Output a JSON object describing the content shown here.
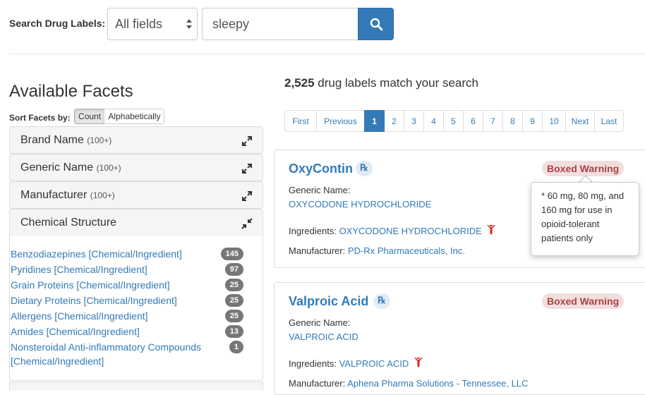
{
  "search": {
    "label": "Search Drug Labels:",
    "field_selected": "All fields",
    "query": "sleepy"
  },
  "facets": {
    "title": "Available Facets",
    "sort_label": "Sort Facets by:",
    "sort_options": [
      "Count",
      "Alphabetically"
    ],
    "panels": [
      {
        "name": "Brand Name",
        "count": "(100+)"
      },
      {
        "name": "Generic Name",
        "count": "(100+)"
      },
      {
        "name": "Manufacturer",
        "count": "(100+)"
      },
      {
        "name": "Chemical Structure",
        "count": ""
      }
    ],
    "chemical_items": [
      {
        "label": "Benzodiazepines [Chemical/Ingredient]",
        "count": "145"
      },
      {
        "label": "Pyridines [Chemical/Ingredient]",
        "count": "97"
      },
      {
        "label": "Grain Proteins [Chemical/Ingredient]",
        "count": "25"
      },
      {
        "label": "Dietary Proteins [Chemical/Ingredient]",
        "count": "25"
      },
      {
        "label": "Allergens [Chemical/Ingredient]",
        "count": "25"
      },
      {
        "label": "Amides [Chemical/Ingredient]",
        "count": "13"
      },
      {
        "label": "Nonsteroidal Anti-inflammatory Compounds [Chemical/Ingredient]",
        "count": "1"
      }
    ]
  },
  "results": {
    "count": "2,525",
    "count_suffix": "drug labels match your search",
    "pagination": [
      "First",
      "Previous",
      "1",
      "2",
      "3",
      "4",
      "5",
      "6",
      "7",
      "8",
      "9",
      "10",
      "Next",
      "Last"
    ],
    "active_page": "1",
    "labels": {
      "generic": "Generic Name:",
      "ingredients": "Ingredients:",
      "manufacturer": "Manufacturer:",
      "rx": "℞",
      "boxed_warning": "Boxed Warning"
    },
    "items": [
      {
        "name": "OxyContin",
        "generic": "OXYCODONE HYDROCHLORIDE",
        "ingredients": "OXYCODONE HYDROCHLORIDE",
        "manufacturer": "PD-Rx Pharmaceuticals, Inc."
      },
      {
        "name": "Valproic Acid",
        "generic": "VALPROIC ACID",
        "ingredients": "VALPROIC ACID",
        "manufacturer": "Aphena Pharma Solutions - Tennessee, LLC"
      }
    ],
    "tooltip": "* 60 mg, 80 mg, and 160 mg for use in opioid-tolerant patients only"
  },
  "colors": {
    "primary": "#337ab7",
    "warning_bg": "#f2dede",
    "warning_text": "#a94442",
    "badge": "#777777",
    "toxic_icon": "#d9261c"
  },
  "icons": {
    "search_button": "search-icon",
    "panel_toggle_collapsed": "expand-icon",
    "panel_toggle_open": "compress-icon",
    "ingredient_marker": "toxic-flask-icon"
  }
}
